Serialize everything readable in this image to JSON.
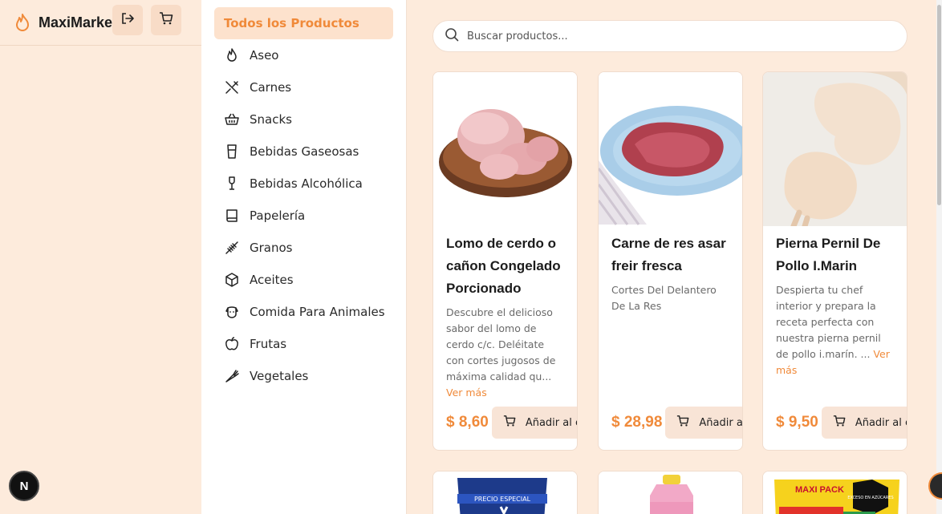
{
  "brand": {
    "name": "MaxiMarket",
    "icon": "flame-icon",
    "accent": "#f08a3a"
  },
  "header": {
    "logout_icon": "logout-icon",
    "cart_icon": "cart-icon"
  },
  "categories": [
    {
      "label": "Todos los Productos",
      "icon": "",
      "active": true
    },
    {
      "label": "Aseo",
      "icon": "flame-icon"
    },
    {
      "label": "Carnes",
      "icon": "utensils-icon"
    },
    {
      "label": "Snacks",
      "icon": "basket-icon"
    },
    {
      "label": "Bebidas Gaseosas",
      "icon": "cup-icon"
    },
    {
      "label": "Bebidas Alcohólica",
      "icon": "wine-icon"
    },
    {
      "label": "Papelería",
      "icon": "book-icon"
    },
    {
      "label": "Granos",
      "icon": "wheat-icon"
    },
    {
      "label": "Aceites",
      "icon": "box-icon"
    },
    {
      "label": "Comida Para Animales",
      "icon": "dog-icon"
    },
    {
      "label": "Frutas",
      "icon": "apple-icon"
    },
    {
      "label": "Vegetales",
      "icon": "carrot-icon"
    }
  ],
  "search": {
    "placeholder": "Buscar productos..."
  },
  "products": [
    {
      "title": "Lomo de cerdo o cañon Congelado Porcionado",
      "description": "Descubre el delicioso sabor del lomo de cerdo c/c. Deléitate con cortes jugosos de máxima calidad qu...",
      "more": "Ver más",
      "price": "$ 8,60",
      "add_label": "Añadir al carrito"
    },
    {
      "title": "Carne de res asar freir fresca",
      "description": "Cortes Del Delantero De La Res",
      "more": "",
      "price": "$ 28,98",
      "add_label": "Añadir al carrito"
    },
    {
      "title": "Pierna Pernil De Pollo I.Marin",
      "description": "Despierta tu chef interior y prepara la receta perfecta con nuestra pierna pernil de pollo i.marín. ...",
      "more": "Ver más",
      "price": "$ 9,50",
      "add_label": "Añadir al carrito"
    }
  ],
  "bottom_products": {
    "p1_tag": "PRECIO ESPECIAL",
    "p3_brand": "MAXI PACK",
    "p3_tag": "EXCESO EN AZÚCARES"
  },
  "dev_badge": {
    "letter": "N"
  }
}
